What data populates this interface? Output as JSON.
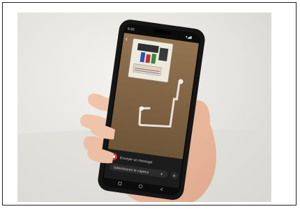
{
  "phone": {
    "status_time": "9:42",
    "status_icons": "▾◢▮",
    "message_placeholder": "Envoyer un message",
    "selector_label": "Sélectionner le capteur",
    "selector_chevron": "▾",
    "plus_symbol": "+",
    "back_symbol": "‹"
  },
  "colors": {
    "board": "#efe9dc",
    "cardboard": "#8a6d4c",
    "phone_body": "#161616",
    "accent_red": "#d6333a"
  }
}
